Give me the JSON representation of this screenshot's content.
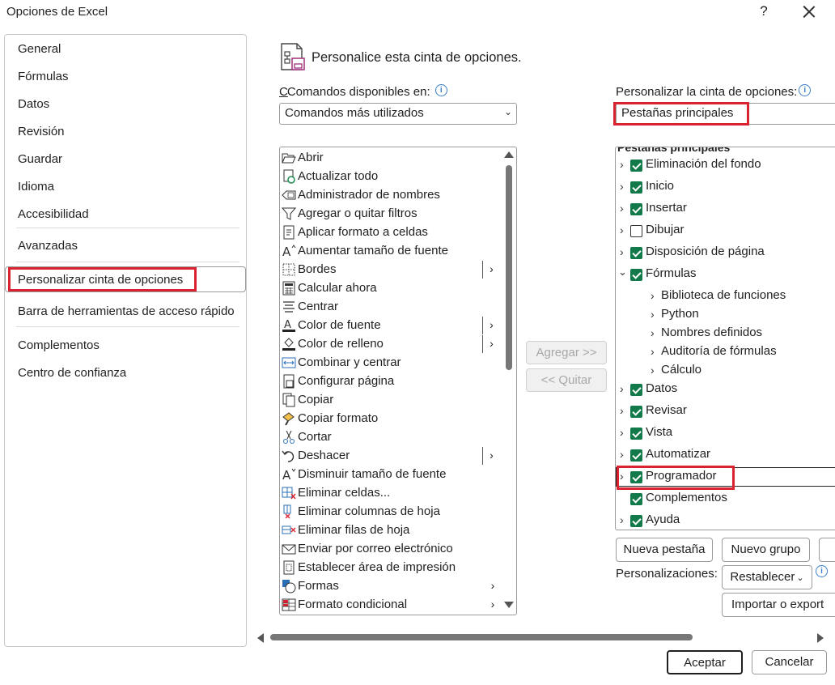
{
  "window": {
    "title": "Opciones de Excel",
    "help_label": "?"
  },
  "nav": {
    "items": [
      "General",
      "Fórmulas",
      "Datos",
      "Revisión",
      "Guardar",
      "Idioma",
      "Accesibilidad",
      "Avanzadas",
      "Personalizar cinta de opciones",
      "Barra de herramientas de acceso rápido",
      "Complementos",
      "Centro de confianza"
    ],
    "selected": "Personalizar cinta de opciones"
  },
  "header": {
    "title": "Personalice esta cinta de opciones."
  },
  "commands": {
    "label": "Comandos disponibles en:",
    "dropdown_value": "Comandos más utilizados",
    "items": [
      {
        "label": "Abrir",
        "icon": "folder-open-icon"
      },
      {
        "label": "Actualizar todo",
        "icon": "refresh-all-icon"
      },
      {
        "label": "Administrador de nombres",
        "icon": "name-manager-icon"
      },
      {
        "label": "Agregar o quitar filtros",
        "icon": "filter-icon"
      },
      {
        "label": "Aplicar formato a celdas",
        "icon": "format-cells-icon"
      },
      {
        "label": "Aumentar tamaño de fuente",
        "icon": "increase-font-icon"
      },
      {
        "label": "Bordes",
        "icon": "borders-icon"
      },
      {
        "label": "Calcular ahora",
        "icon": "calculator-icon"
      },
      {
        "label": "Centrar",
        "icon": "align-center-icon"
      },
      {
        "label": "Color de fuente",
        "icon": "font-color-icon"
      },
      {
        "label": "Color de relleno",
        "icon": "fill-color-icon"
      },
      {
        "label": "Combinar y centrar",
        "icon": "merge-center-icon"
      },
      {
        "label": "Configurar página",
        "icon": "page-setup-icon"
      },
      {
        "label": "Copiar",
        "icon": "copy-icon"
      },
      {
        "label": "Copiar formato",
        "icon": "format-painter-icon"
      },
      {
        "label": "Cortar",
        "icon": "scissors-icon"
      },
      {
        "label": "Deshacer",
        "icon": "undo-icon"
      },
      {
        "label": "Disminuir tamaño de fuente",
        "icon": "decrease-font-icon"
      },
      {
        "label": "Eliminar celdas...",
        "icon": "delete-cells-icon"
      },
      {
        "label": "Eliminar columnas de hoja",
        "icon": "delete-columns-icon"
      },
      {
        "label": "Eliminar filas de hoja",
        "icon": "delete-rows-icon"
      },
      {
        "label": "Enviar por correo electrónico",
        "icon": "email-icon"
      },
      {
        "label": "Establecer área de impresión",
        "icon": "print-area-icon"
      },
      {
        "label": "Formas",
        "icon": "shapes-icon"
      },
      {
        "label": "Formato condicional",
        "icon": "conditional-format-icon"
      }
    ]
  },
  "middle_buttons": {
    "add": "Agregar >>",
    "remove": "<< Quitar"
  },
  "ribbon": {
    "label": "Personalizar la cinta de opciones:",
    "dropdown_value": "Pestañas principales",
    "tree_header": "Pestañas principales",
    "tabs": [
      {
        "label": "Eliminación del fondo",
        "checked": true,
        "expanded": false
      },
      {
        "label": "Inicio",
        "checked": true,
        "expanded": false
      },
      {
        "label": "Insertar",
        "checked": true,
        "expanded": false
      },
      {
        "label": "Dibujar",
        "checked": false,
        "expanded": false
      },
      {
        "label": "Disposición de página",
        "checked": true,
        "expanded": false
      },
      {
        "label": "Fórmulas",
        "checked": true,
        "expanded": true
      },
      {
        "label": "Biblioteca de funciones",
        "child": true
      },
      {
        "label": "Python",
        "child": true
      },
      {
        "label": "Nombres definidos",
        "child": true
      },
      {
        "label": "Auditoría de fórmulas",
        "child": true
      },
      {
        "label": "Cálculo",
        "child": true
      },
      {
        "label": "Datos",
        "checked": true,
        "expanded": false
      },
      {
        "label": "Revisar",
        "checked": true,
        "expanded": false
      },
      {
        "label": "Vista",
        "checked": true,
        "expanded": false
      },
      {
        "label": "Automatizar",
        "checked": true,
        "expanded": false
      },
      {
        "label": "Programador",
        "checked": true,
        "expanded": false
      },
      {
        "label": "Complementos",
        "checked": true,
        "no_expander": true
      },
      {
        "label": "Ayuda",
        "checked": true,
        "expanded": false
      }
    ],
    "new_tab": "Nueva pestaña",
    "new_group": "Nuevo grupo",
    "customizations_label": "Personalizaciones:",
    "reset": "Restablecer",
    "import_export": "Importar o export"
  },
  "footer": {
    "ok": "Aceptar",
    "cancel": "Cancelar"
  },
  "colors": {
    "highlight_border": "#d9232e",
    "checkbox": "#127a4a"
  }
}
